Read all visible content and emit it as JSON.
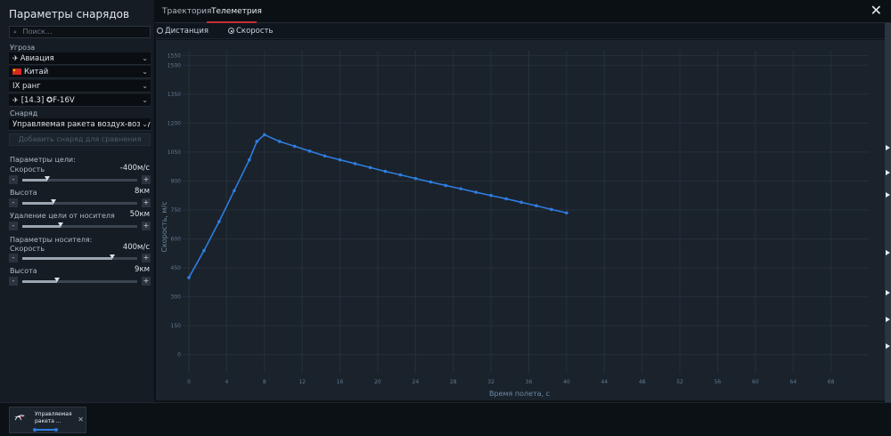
{
  "left_panel": {
    "title": "Параметры снарядов",
    "search_placeholder": "Поиск...",
    "threat_label": "Угроза",
    "threat_type": "Авиация",
    "country": "Китай",
    "rank": "IX ранг",
    "vehicle": "[14.3] ✪F-16V",
    "shell_label": "Снаряд",
    "shell": "Управляемая ракета воздух-воздух AIM",
    "add_button": "Добавить снаряд для сравнения",
    "target_params_label": "Параметры цели:",
    "target_speed_label": "Скорость",
    "target_speed_value": "-400м/с",
    "target_speed_level": 0.22,
    "target_altitude_label": "Высота",
    "target_altitude_value": "8км",
    "target_altitude_level": 0.27,
    "target_distance_label": "Удаление цели от носителя",
    "target_distance_value": "50км",
    "target_distance_level": 0.33,
    "carrier_params_label": "Параметры носителя:",
    "carrier_speed_label": "Скорость",
    "carrier_speed_value": "400м/с",
    "carrier_speed_level": 0.78,
    "carrier_altitude_label": "Высота",
    "carrier_altitude_value": "9км",
    "carrier_altitude_level": 0.3,
    "minus": "-",
    "plus": "+"
  },
  "tabs": [
    "Траектория",
    "Телеметрия"
  ],
  "active_tab": "Телеметрия",
  "close": "✕",
  "radio": {
    "distance": "Дистанция",
    "speed": "Скорость",
    "selected": "speed"
  },
  "bottom": {
    "card_title_1": "Управляемая",
    "card_title_2": "ракета ...",
    "close": "✕"
  },
  "colors": {
    "accent_red": "#c4303a",
    "series_blue": "#2e7de0"
  },
  "chart_data": {
    "type": "line",
    "xlabel": "Время полета, с",
    "ylabel": "Скорость, м/с",
    "xlim": [
      0,
      72
    ],
    "ylim": [
      -75,
      1575
    ],
    "x_ticks": [
      0,
      4,
      8,
      12,
      16,
      20,
      24,
      28,
      32,
      36,
      40,
      44,
      48,
      52,
      56,
      60,
      64,
      68
    ],
    "y_ticks": [
      0,
      150,
      300,
      450,
      600,
      750,
      900,
      1050,
      1200,
      1350,
      1500,
      1550
    ],
    "grid": true,
    "series": [
      {
        "x": [
          0,
          1.6,
          3.2,
          4.8,
          6.4,
          7.2,
          8,
          9.6,
          11.2,
          12.8,
          14.4,
          16,
          17.6,
          19.2,
          20.8,
          22.4,
          24,
          25.6,
          27.2,
          28.8,
          30.4,
          32,
          33.6,
          35.2,
          36.8,
          38.4,
          40
        ],
        "y": [
          400,
          540,
          690,
          850,
          1010,
          1105,
          1140,
          1105,
          1080,
          1055,
          1030,
          1010,
          990,
          970,
          950,
          932,
          913,
          895,
          877,
          860,
          842,
          825,
          808,
          790,
          772,
          753,
          735
        ]
      }
    ]
  }
}
